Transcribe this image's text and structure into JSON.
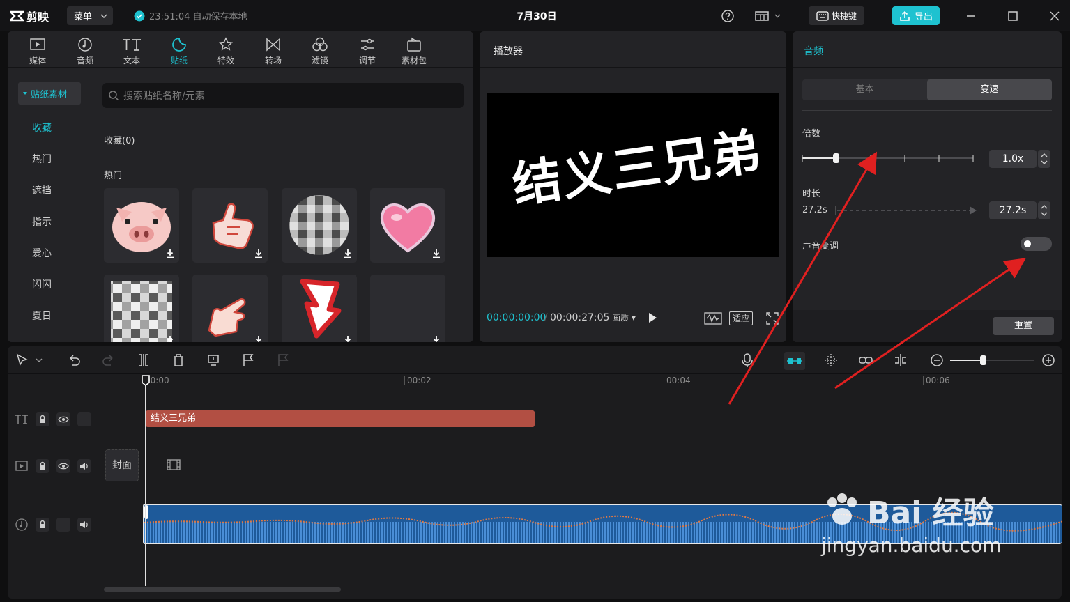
{
  "titlebar": {
    "app_name": "剪映",
    "menu_label": "菜单",
    "autosave_text": "23:51:04 自动保存本地",
    "project_title": "7月30日",
    "shortcut_label": "快捷键",
    "export_label": "导出"
  },
  "toolbar": {
    "tabs": [
      {
        "label": "媒体",
        "icon": "media-icon"
      },
      {
        "label": "音频",
        "icon": "audio-icon"
      },
      {
        "label": "文本",
        "icon": "text-icon"
      },
      {
        "label": "贴纸",
        "icon": "sticker-icon",
        "active": true
      },
      {
        "label": "特效",
        "icon": "effects-icon"
      },
      {
        "label": "转场",
        "icon": "transition-icon"
      },
      {
        "label": "滤镜",
        "icon": "filter-icon"
      },
      {
        "label": "调节",
        "icon": "adjust-icon"
      },
      {
        "label": "素材包",
        "icon": "package-icon"
      }
    ]
  },
  "sidebar": {
    "category_button": "贴纸素材",
    "items": [
      "收藏",
      "热门",
      "遮挡",
      "指示",
      "爱心",
      "闪闪",
      "夏日"
    ]
  },
  "stickers": {
    "search_placeholder": "搜索贴纸名称/元素",
    "favorites_label": "收藏(0)",
    "hot_label": "热门"
  },
  "player": {
    "title": "播放器",
    "video_text": "结义三兄弟",
    "current_time": "00:00:00:00",
    "total_time": "00:00:27:05",
    "quality_label": "画质",
    "fit_label": "适应"
  },
  "properties": {
    "title": "音频",
    "tab_basic": "基本",
    "tab_speed": "变速",
    "speed_label": "倍数",
    "speed_value": "1.0x",
    "duration_label": "时长",
    "duration_start": "27.2s",
    "duration_value": "27.2s",
    "pitch_label": "声音变调",
    "pitch_on": false,
    "reset_label": "重置"
  },
  "timeline": {
    "ruler": [
      "00:00",
      "00:02",
      "00:04",
      "00:06"
    ],
    "text_clip": "结义三兄弟",
    "cover_label": "封面"
  },
  "watermark": {
    "brand": "Bai 经验",
    "url": "jingyan.baidu.com"
  },
  "colors": {
    "accent": "#1ec2d0",
    "text_clip": "#b24f43",
    "audio_clip": "#1e5a9a",
    "annotation_arrow": "#e02020"
  }
}
